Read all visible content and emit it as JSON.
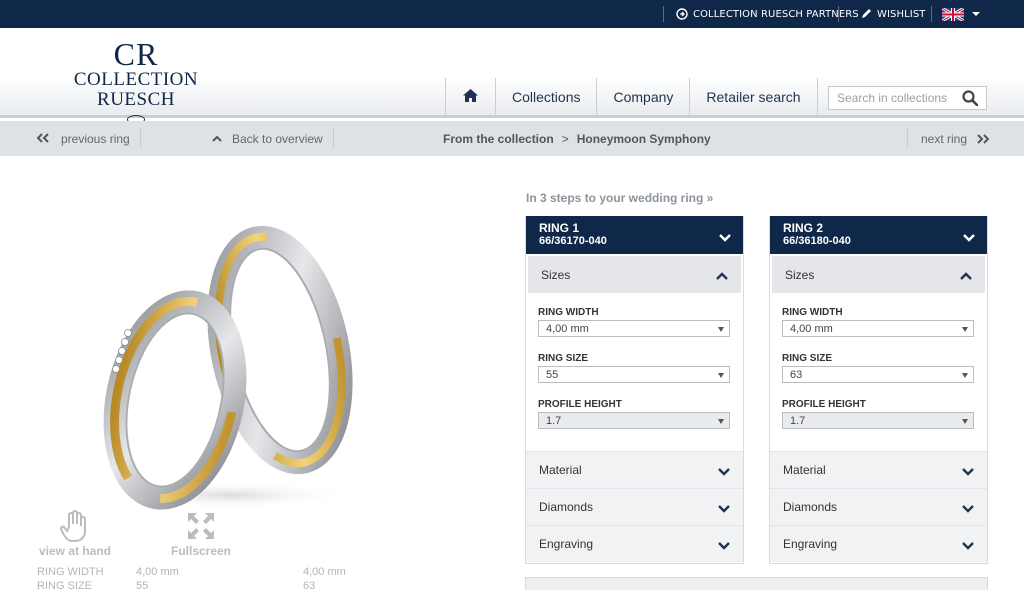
{
  "topbar": {
    "partners_label": "COLLECTION RUESCH PARTNERS",
    "wishlist_label": "WISHLIST",
    "language": "English"
  },
  "logo": {
    "monogram": "CR",
    "brand": "COLLECTION RUESCH"
  },
  "nav": {
    "items": [
      "Collections",
      "Company",
      "Retailer search"
    ]
  },
  "search": {
    "placeholder": "Search in collections"
  },
  "breadcrumb": {
    "previous": "previous ring",
    "back": "Back to overview",
    "from": "From the collection",
    "collection": "Honeymoon Symphony",
    "next": "next ring"
  },
  "tools": {
    "view_at_hand": "view at hand",
    "fullscreen": "Fullscreen"
  },
  "specs": [
    {
      "label": "RING WIDTH",
      "ring1": "4,00 mm",
      "ring2": "4,00 mm"
    },
    {
      "label": "RING SIZE",
      "ring1": "55",
      "ring2": "63"
    }
  ],
  "steps_link": "In 3 steps to your wedding ring »",
  "rings": [
    {
      "title": "RING 1",
      "code": "66/36170-040",
      "sizes_label": "Sizes",
      "width_label": "RING WIDTH",
      "width_value": "4,00 mm",
      "size_label": "RING SIZE",
      "size_value": "55",
      "profile_label": "PROFILE HEIGHT",
      "profile_value": "1.7",
      "material_label": "Material",
      "diamonds_label": "Diamonds",
      "engraving_label": "Engraving"
    },
    {
      "title": "RING 2",
      "code": "66/36180-040",
      "sizes_label": "Sizes",
      "width_label": "RING WIDTH",
      "width_value": "4,00 mm",
      "size_label": "RING SIZE",
      "size_value": "63",
      "profile_label": "PROFILE HEIGHT",
      "profile_value": "1.7",
      "material_label": "Material",
      "diamonds_label": "Diamonds",
      "engraving_label": "Engraving"
    }
  ],
  "colors": {
    "navy": "#0f2748",
    "gold": "#d8b24a",
    "silver": "#c7c9cc"
  }
}
